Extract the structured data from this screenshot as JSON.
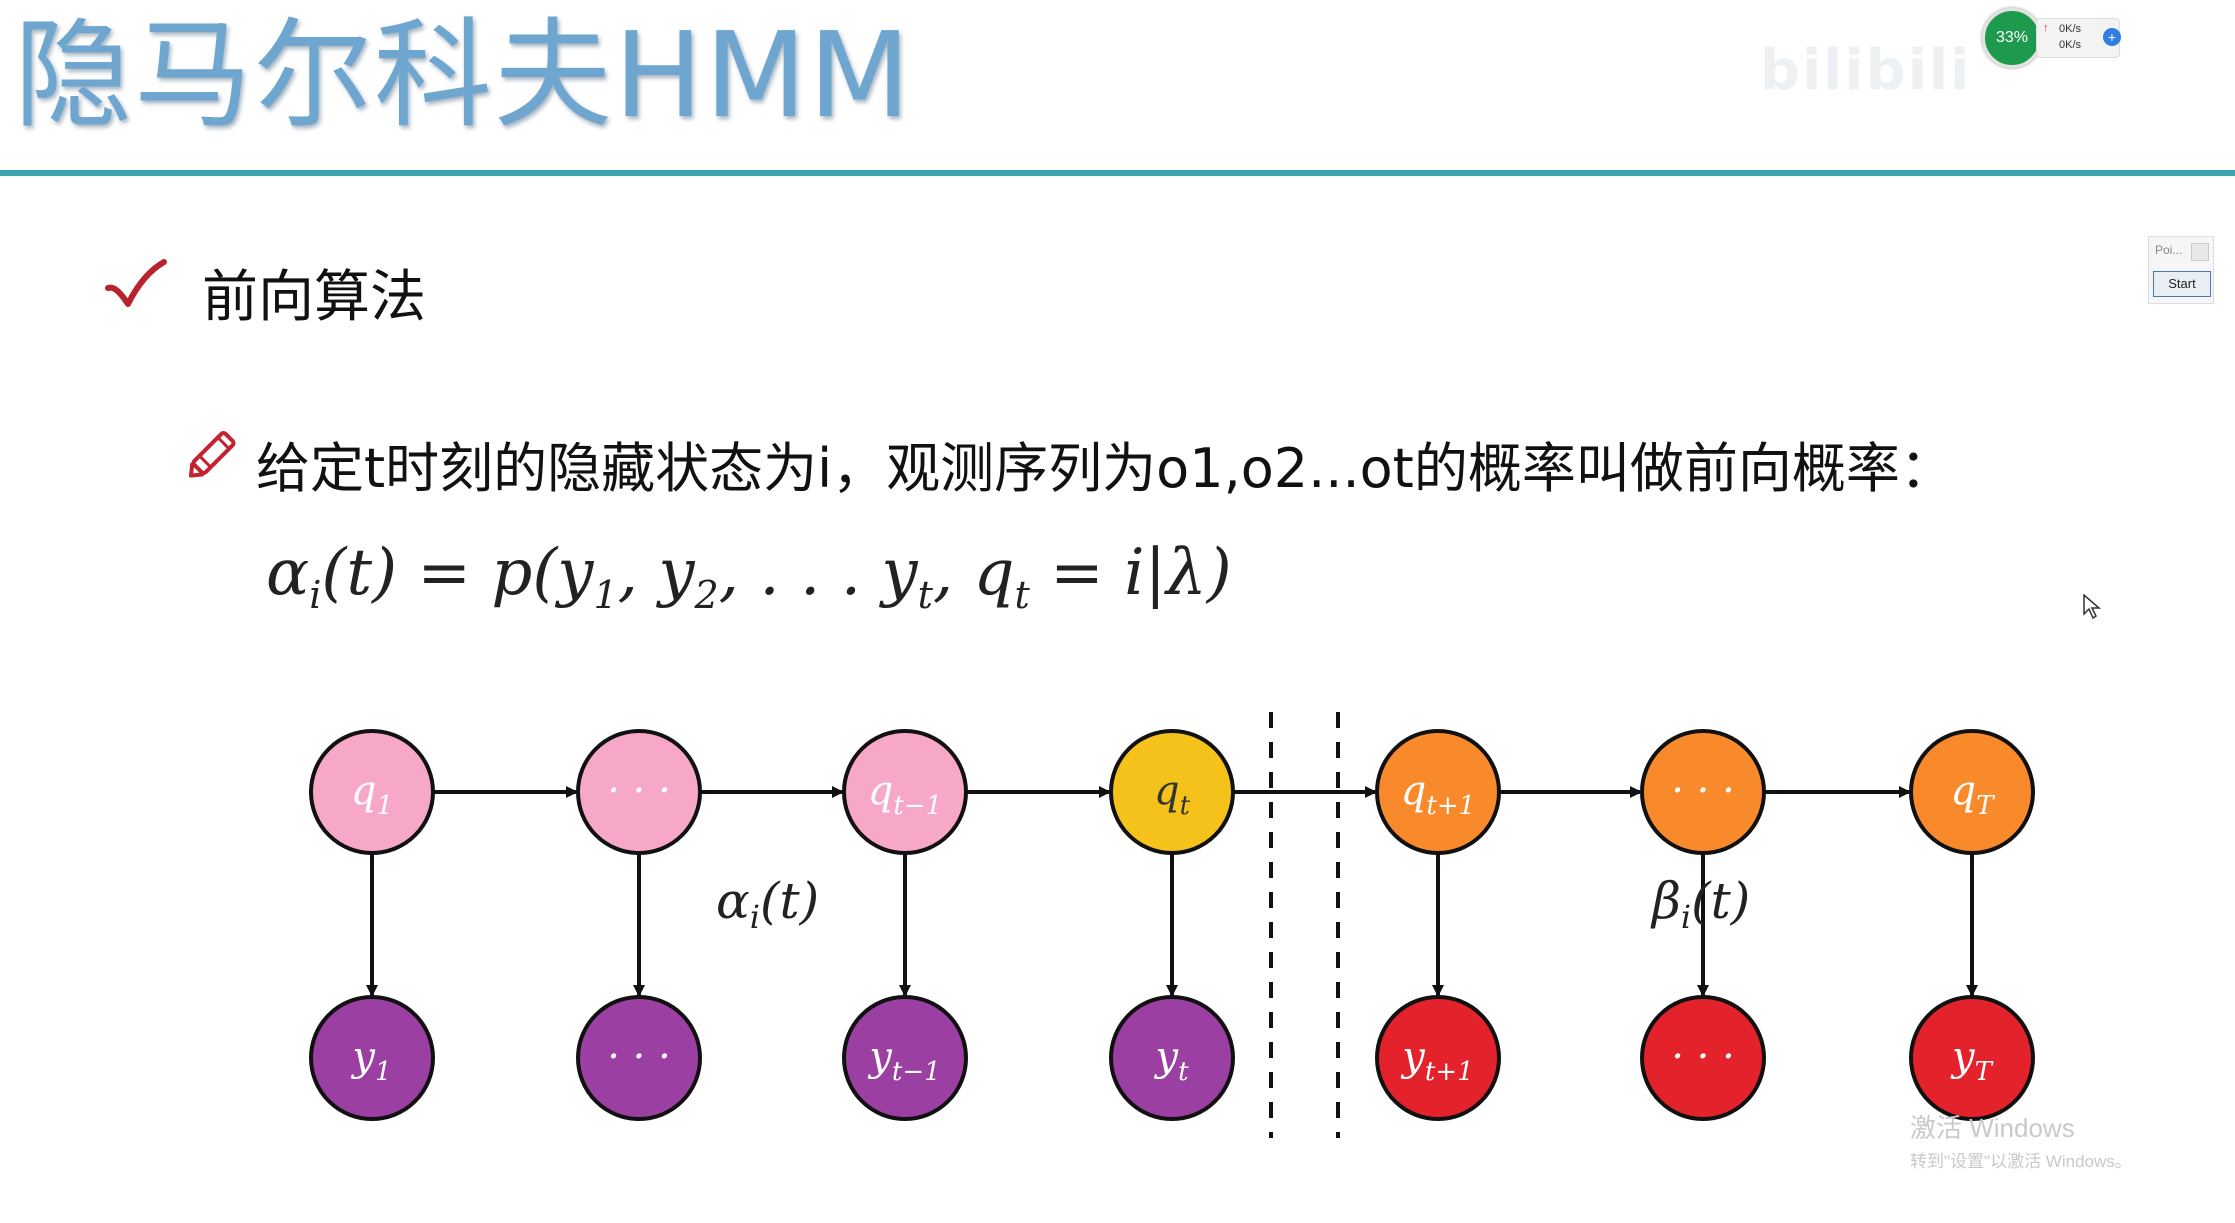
{
  "slide": {
    "title": "隐马尔科夫HMM",
    "heading": "前向算法",
    "description": "给定t时刻的隐藏状态为i，观测序列为o1,o2...ot的概率叫做前向概率：",
    "formula": {
      "lhs": "α",
      "lhs_sub": "i",
      "lhs_arg": "(t) = p(y",
      "s1": "1",
      "mid1": ", y",
      "s2": "2",
      "mid2": ", . . . y",
      "s3": "t",
      "mid3": ", q",
      "s4": "t",
      "rhs": " = i|λ)"
    }
  },
  "diagram": {
    "hidden_states": [
      {
        "label": "q",
        "sub": "1",
        "color": "#f7a8c8"
      },
      {
        "label": "· · ·",
        "sub": "",
        "color": "#f7a8c8"
      },
      {
        "label": "q",
        "sub": "t−1",
        "color": "#f7a8c8"
      },
      {
        "label": "q",
        "sub": "t",
        "color": "#f5c21b"
      },
      {
        "label": "q",
        "sub": "t+1",
        "color": "#f98a2b"
      },
      {
        "label": "· · ·",
        "sub": "",
        "color": "#f98a2b"
      },
      {
        "label": "q",
        "sub": "T",
        "color": "#f98a2b"
      }
    ],
    "observations": [
      {
        "label": "y",
        "sub": "1",
        "color": "#9b3fa3"
      },
      {
        "label": "· · ·",
        "sub": "",
        "color": "#9b3fa3"
      },
      {
        "label": "y",
        "sub": "t−1",
        "color": "#9b3fa3"
      },
      {
        "label": "y",
        "sub": "t",
        "color": "#9b3fa3"
      },
      {
        "label": "y",
        "sub": "t+1",
        "color": "#e3222b"
      },
      {
        "label": "· · ·",
        "sub": "",
        "color": "#e3222b"
      },
      {
        "label": "y",
        "sub": "T",
        "color": "#e3222b"
      }
    ],
    "alpha_label": {
      "sym": "α",
      "sub": "i",
      "arg": "(t)"
    },
    "beta_label": {
      "sym": "β",
      "sub": "i",
      "arg": "(t)"
    }
  },
  "widgets": {
    "cpu_percent": "33%",
    "upload_speed": "0K/s",
    "download_speed": "0K/s",
    "ppt_label": "Poi...",
    "ppt_start": "Start",
    "watermark": "bilibili"
  },
  "activation": {
    "main": "激活 Windows",
    "sub": "转到\"设置\"以激活 Windows。"
  }
}
